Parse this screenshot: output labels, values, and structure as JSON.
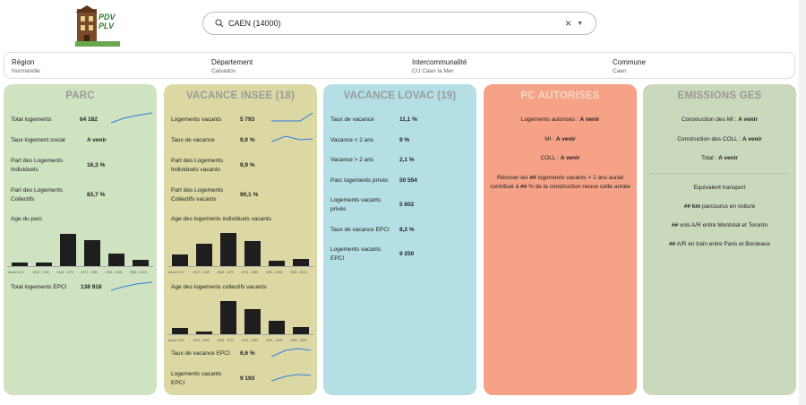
{
  "logo": {
    "line1": "PDV",
    "line2": "PLV"
  },
  "search": {
    "value": "CAEN (14000)"
  },
  "crumbs": [
    {
      "label": "Région",
      "value": "Normandie"
    },
    {
      "label": "Département",
      "value": "Calvados"
    },
    {
      "label": "Intercommunalité",
      "value": "CU Caen la Mer"
    },
    {
      "label": "Commune",
      "value": "Caen"
    }
  ],
  "colors": {
    "parc": "#cfe3c0",
    "vacance": "#dcd8a3",
    "lovac": "#b3dfe5",
    "pc": "#f6a287",
    "ges": "#cad8bb",
    "spark": "#2b7de1"
  },
  "parc": {
    "title": "PARC",
    "rows": [
      {
        "k": "Total logements",
        "v": "64 182"
      },
      {
        "k": "Taux logement social",
        "v": "A venir"
      },
      {
        "k": "Part des Logements Individuels",
        "v": "16,3 %"
      },
      {
        "k": "Part des Logements Collectifs",
        "v": "83,7 %"
      }
    ],
    "age_title": "Age du parc",
    "epci_k": "Total logements EPCI",
    "epci_v": "138 918"
  },
  "vacance": {
    "title": "VACANCE INSEE (18)",
    "rows": [
      {
        "k": "Logements vacants",
        "v": "5 793"
      },
      {
        "k": "Taux de vacance",
        "v": "9,0 %"
      },
      {
        "k": "Part des Logements Individuels vacants",
        "v": "9,9 %"
      },
      {
        "k": "Part des Logements Collectifs vacants",
        "v": "90,1 %"
      }
    ],
    "age_ind_title": "Age des logements individuels vacants",
    "age_col_title": "Age des logements collectifs vacants",
    "epci_rows": [
      {
        "k": "Taux de vacance EPCI",
        "v": "6,6 %"
      },
      {
        "k": "Logements vacants EPCI",
        "v": "9 193"
      }
    ]
  },
  "lovac": {
    "title": "VACANCE LOVAC (19)",
    "rows": [
      {
        "k": "Taux de vacance",
        "v": "11,1 %"
      },
      {
        "k": "Vacance < 2 ans",
        "v": "9 %"
      },
      {
        "k": "Vacance > 2 ans",
        "v": "2,1 %"
      },
      {
        "k": "Parc logements privés",
        "v": "50 554"
      },
      {
        "k": "Logements vacants privés",
        "v": "5 602"
      },
      {
        "k": "Taux de vacance EPCI",
        "v": "8,2 %"
      },
      {
        "k": "Logements vacants EPCI",
        "v": "9 250"
      }
    ]
  },
  "pc": {
    "title": "PC AUTORISES",
    "l1_k": "Logements autorisés : ",
    "l1_v": "A venir",
    "l2_k": "MI : ",
    "l2_v": "A venir",
    "l3_k": "COLL : ",
    "l3_v": "A venir",
    "p_a": "Rénover les ",
    "p_b": "##",
    "p_c": " logements vacants > 2 ans aurait contribué à ",
    "p_d": "##",
    "p_e": " % de la construction neuve cette année"
  },
  "ges": {
    "title": "EMISSIONS GES",
    "l1_k": "Construction des MI : ",
    "l1_v": "A venir",
    "l2_k": "Construction des COLL : ",
    "l2_v": "A venir",
    "l3_k": "Total : ",
    "l3_v": "A venir",
    "equiv": "Equivalent transport",
    "e1_b": "## km",
    "e1_t": " parcourus en voiture",
    "e2_b": "##",
    "e2_t": " vols A/R entre Montréal et Toronto",
    "e3_b": "##",
    "e3_t": " A/R en train entre Paris et Bordeaux"
  },
  "age_categories": [
    "Avant 1919",
    "1919 - 1945",
    "1946 - 1970",
    "1971 - 1990",
    "1991 - 2005",
    "2006 - 2015"
  ],
  "age_parc_values": [
    5,
    5,
    40,
    33,
    16,
    8
  ],
  "age_ind_values": [
    15,
    28,
    42,
    31,
    7,
    9
  ],
  "age_col_values": [
    8,
    3,
    42,
    32,
    17,
    9
  ]
}
